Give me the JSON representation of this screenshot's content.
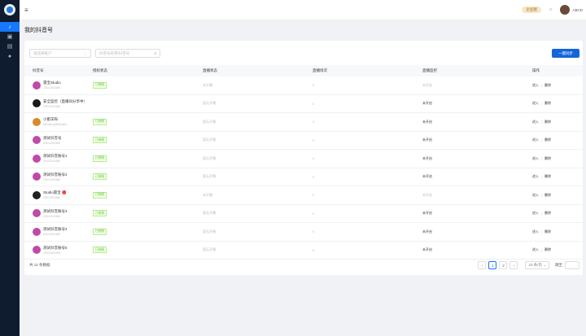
{
  "sidebar": {
    "items": [
      {
        "icon": "tiktok-icon",
        "label": "♪",
        "active": true
      },
      {
        "icon": "box-icon",
        "label": "▣",
        "active": false
      },
      {
        "icon": "video-icon",
        "label": "▤",
        "active": false
      },
      {
        "icon": "user-icon",
        "label": "●",
        "active": false
      }
    ]
  },
  "topbar": {
    "menu_icon": "≡",
    "vip_label": "企业版",
    "bell": "⌂",
    "username": "ABCD"
  },
  "page_title": "我的抖音号",
  "filters": {
    "select_placeholder": "请选择账户",
    "search_placeholder": "抖音号名称/抖音号",
    "search_icon": "⌕"
  },
  "sync_button": "一键同步",
  "columns": [
    "抖音号",
    "授权状态",
    "直播状态",
    "直播场次",
    "直播监控",
    "操作"
  ],
  "rows": [
    {
      "name": "雷宝Studio",
      "sub": "2301242480",
      "avatar": "#c04aa8",
      "auth": "已授权",
      "live": "未开播",
      "count": "0",
      "monitor": "未开启",
      "ops": [
        "进入",
        "删除"
      ],
      "mon_dark": false
    },
    {
      "name": "安全监控（直播间分享中）",
      "sub": "2301242480",
      "avatar": "#1a1a1a",
      "auth": "",
      "live": "暂无开播",
      "count": "0",
      "monitor": "未开启",
      "ops": [
        "进入",
        "删除"
      ],
      "mon_dark": true
    },
    {
      "name": "小肥羊呀",
      "sub": "MS4wLjABAAAA",
      "avatar": "#d88a2a",
      "auth": "已授权",
      "live": "暂无开播",
      "count": "0",
      "monitor": "未开启",
      "ops": [
        "进入",
        "删除"
      ],
      "mon_dark": true
    },
    {
      "name": "测试抖音号",
      "sub": "2301242480",
      "avatar": "#c04aa8",
      "auth": "已授权",
      "live": "暂无开播",
      "count": "0",
      "monitor": "未开启",
      "ops": [
        "进入",
        "删除"
      ],
      "mon_dark": true
    },
    {
      "name": "测试抖音账号1",
      "sub": "2301242480",
      "avatar": "#c04aa8",
      "auth": "已授权",
      "live": "暂无开播",
      "count": "0",
      "monitor": "未开启",
      "ops": [
        "进入",
        "删除"
      ],
      "mon_dark": true
    },
    {
      "name": "测试抖音账号2",
      "sub": "2301242480",
      "avatar": "#c04aa8",
      "auth": "已授权",
      "live": "暂无开播",
      "count": "0",
      "monitor": "未开启",
      "ops": [
        "进入",
        "删除"
      ],
      "mon_dark": true
    },
    {
      "name": "Studio雷宝 🔴",
      "sub": "2301242480",
      "avatar": "#222222",
      "auth": "已授权",
      "live": "未开播",
      "count": "0",
      "monitor": "未开启",
      "ops": [
        "进入",
        "删除"
      ],
      "mon_dark": false
    },
    {
      "name": "测试抖音账号3",
      "sub": "2301242480",
      "avatar": "#c04aa8",
      "auth": "已授权",
      "live": "暂无开播",
      "count": "0",
      "monitor": "未开启",
      "ops": [
        "进入",
        "删除"
      ],
      "mon_dark": true
    },
    {
      "name": "测试抖音账号4",
      "sub": "2301242480",
      "avatar": "#c04aa8",
      "auth": "已授权",
      "live": "暂无开播",
      "count": "0",
      "monitor": "未开启",
      "ops": [
        "进入",
        "删除"
      ],
      "mon_dark": true
    },
    {
      "name": "测试抖音账号5",
      "sub": "2301242480",
      "avatar": "#c04aa8",
      "auth": "已授权",
      "live": "暂无开播",
      "count": "0",
      "monitor": "未开启",
      "ops": [
        "进入",
        "删除"
      ],
      "mon_dark": true
    }
  ],
  "footer": {
    "total": "共 12 条数据",
    "prev": "‹",
    "pages": [
      "1",
      "2"
    ],
    "next": "›",
    "page_size": "10 条/页 ⌄",
    "jump_label": "跳至",
    "jump_suffix": "页"
  }
}
